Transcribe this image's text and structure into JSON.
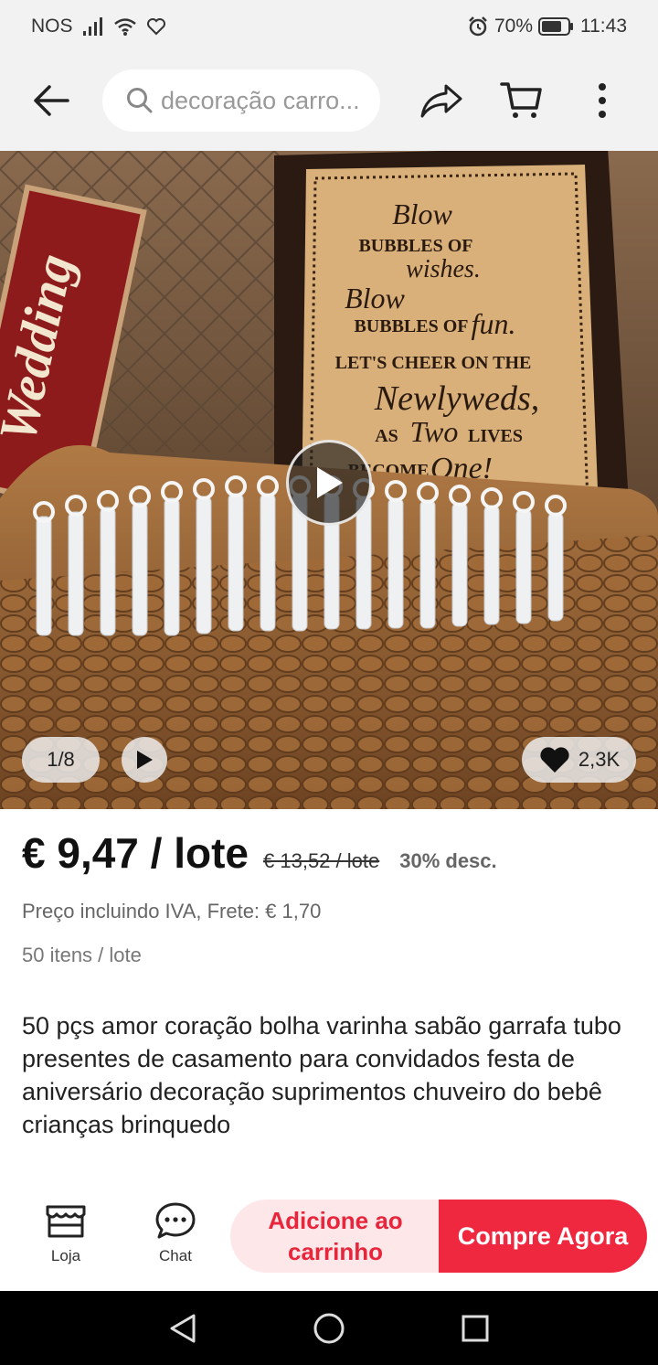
{
  "status_bar": {
    "carrier": "NOS",
    "battery": "70%",
    "time": "11:43"
  },
  "header": {
    "search_placeholder": "decoração carro...",
    "icons": [
      "back-arrow-icon",
      "search-icon",
      "share-icon",
      "cart-icon",
      "more-vertical-icon"
    ]
  },
  "gallery": {
    "page_indicator": "1/8",
    "likes": "2,3K",
    "image_text": {
      "sign_side": "Wedding",
      "frame_lines": [
        "Blow",
        "BUBBLES OF",
        "wishes.",
        "Blow",
        "BUBBLES OF",
        "fun.",
        "LET'S CHEER ON THE",
        "Newlyweds,",
        "AS",
        "Two",
        "LIVES",
        "BECOME",
        "One!"
      ]
    }
  },
  "product": {
    "price": "€ 9,47 / lote",
    "original_price": "€ 13,52 / lote",
    "discount": "30% desc.",
    "tax_shipping": "Preço incluindo IVA, Frete: € 1,70",
    "lot_info": "50 itens / lote",
    "title": "50 pçs amor coração bolha varinha sabão garrafa tubo presentes de casamento para convidados festa de aniversário decoração suprimentos chuveiro do bebê crianças brinquedo"
  },
  "actions": {
    "store_label": "Loja",
    "chat_label": "Chat",
    "add_to_cart": "Adicione ao carrinho",
    "buy_now": "Compre Agora"
  },
  "colors": {
    "accent": "#f0283f",
    "accent_light": "#fde7e9",
    "bar_bg": "#f2f2f2"
  }
}
